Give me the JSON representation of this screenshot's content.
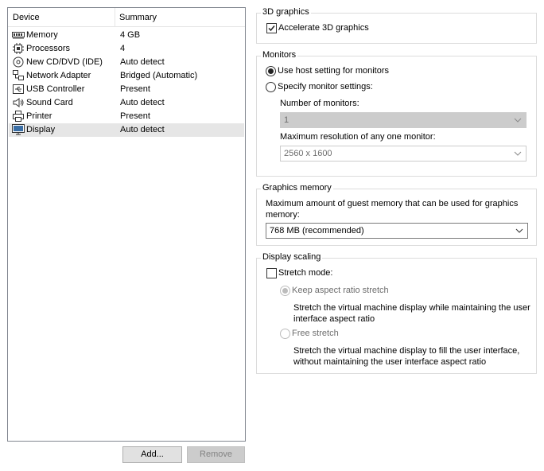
{
  "device_list": {
    "columns": {
      "device": "Device",
      "summary": "Summary"
    },
    "rows": [
      {
        "name": "Memory",
        "summary": "4 GB",
        "icon": "memory-icon"
      },
      {
        "name": "Processors",
        "summary": "4",
        "icon": "processor-icon"
      },
      {
        "name": "New CD/DVD (IDE)",
        "summary": "Auto detect",
        "icon": "cd-dvd-icon"
      },
      {
        "name": "Network Adapter",
        "summary": "Bridged (Automatic)",
        "icon": "network-adapter-icon"
      },
      {
        "name": "USB Controller",
        "summary": "Present",
        "icon": "usb-icon"
      },
      {
        "name": "Sound Card",
        "summary": "Auto detect",
        "icon": "speaker-icon"
      },
      {
        "name": "Printer",
        "summary": "Present",
        "icon": "printer-icon"
      },
      {
        "name": "Display",
        "summary": "Auto detect",
        "icon": "monitor-icon",
        "selected": true
      }
    ]
  },
  "buttons": {
    "add": "Add...",
    "remove": "Remove"
  },
  "graphics3d": {
    "title": "3D graphics",
    "accelerate_label": "Accelerate 3D graphics",
    "accelerate_checked": true
  },
  "monitors": {
    "title": "Monitors",
    "host_setting_label": "Use host setting for monitors",
    "specify_label": "Specify monitor settings:",
    "selected": "host",
    "num_monitors_label": "Number of monitors:",
    "num_monitors_value": "1",
    "max_res_label": "Maximum resolution of any one monitor:",
    "max_res_value": "2560 x 1600"
  },
  "graphics_memory": {
    "title": "Graphics memory",
    "description": "Maximum amount of guest memory that can be used for graphics memory:",
    "value": "768 MB (recommended)"
  },
  "display_scaling": {
    "title": "Display scaling",
    "stretch_label": "Stretch mode:",
    "stretch_checked": false,
    "keep_aspect_label": "Keep aspect ratio stretch",
    "keep_aspect_desc": "Stretch the virtual machine display while maintaining the user interface aspect ratio",
    "free_stretch_label": "Free stretch",
    "free_stretch_desc": "Stretch the virtual machine display to fill the user interface, without maintaining the user interface aspect ratio"
  }
}
